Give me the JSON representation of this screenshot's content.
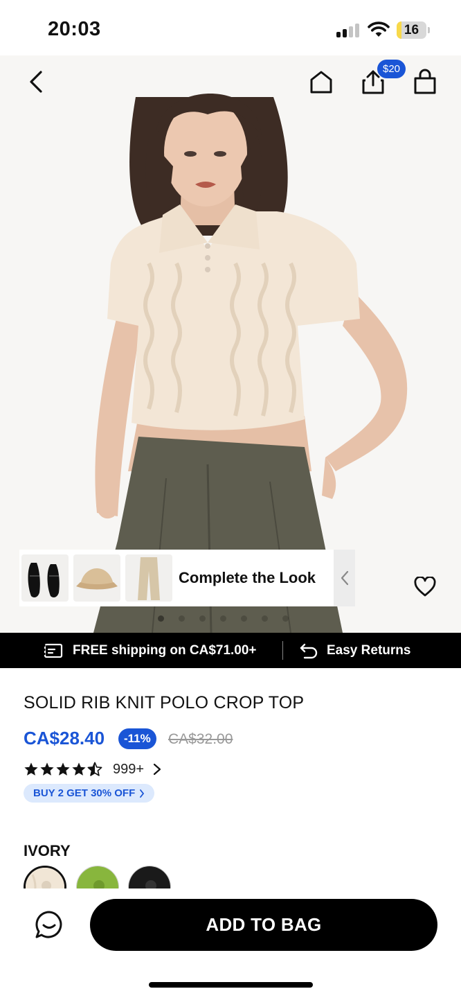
{
  "status_bar": {
    "time": "20:03",
    "battery": "16",
    "battery_level": 0.16,
    "signal_icon": "cellular-signal-icon",
    "wifi_icon": "wifi-icon"
  },
  "nav": {
    "back_icon": "chevron-left-icon",
    "home_icon": "home-icon",
    "share_icon": "share-icon",
    "share_badge": "$20",
    "bag_icon": "shopping-bag-icon"
  },
  "complete_the_look": {
    "label": "Complete the Look",
    "items": [
      "black mary jane flats",
      "beige bucket hat",
      "beige wide-leg trousers"
    ],
    "arrow_icon": "chevron-left-icon"
  },
  "wishlist_icon": "heart-icon",
  "promo": {
    "shipping_icon": "shipping-icon",
    "shipping_text": "FREE shipping on CA$71.00+",
    "returns_icon": "return-arrow-icon",
    "returns_text": "Easy Returns"
  },
  "product": {
    "title": "SOLID RIB KNIT POLO CROP TOP",
    "price": "CA$28.40",
    "discount": "-11%",
    "original_price": "CA$32.00",
    "rating": 4.5,
    "review_count": "999+",
    "deal": "BUY 2 GET 30% OFF",
    "color_label": "IVORY",
    "colors": [
      "ivory",
      "green",
      "black"
    ]
  },
  "colors": {
    "accent": "#1a55d6",
    "deal_bg": "#dce9fd",
    "black": "#000000"
  },
  "bottom": {
    "chat_icon": "chat-icon",
    "add_to_bag": "ADD TO BAG"
  }
}
